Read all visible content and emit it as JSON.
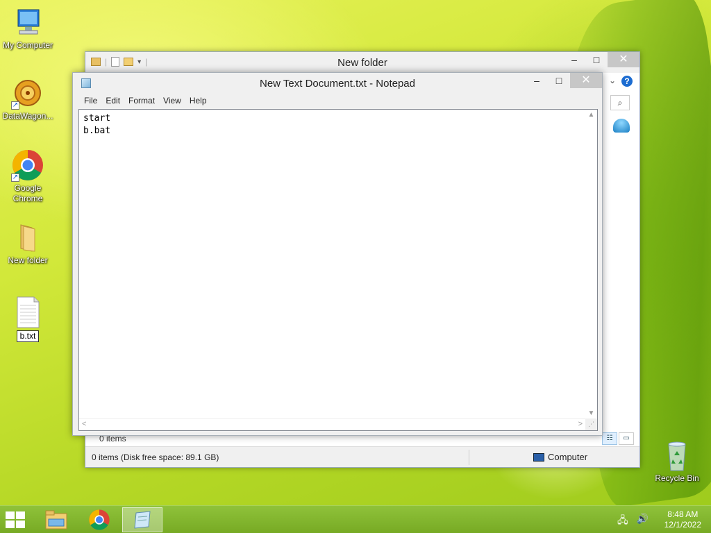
{
  "desktop": {
    "icons": [
      {
        "label": "My Computer",
        "icon": "my-computer-icon"
      },
      {
        "label": "DataWagon...",
        "icon": "datawagon-icon"
      },
      {
        "label": "Google Chrome",
        "icon": "chrome-icon"
      },
      {
        "label": "New folder",
        "icon": "folder-icon"
      },
      {
        "label": "b.txt",
        "icon": "text-file-icon"
      },
      {
        "label": "Recycle Bin",
        "icon": "recycle-bin-icon"
      }
    ]
  },
  "explorer": {
    "title": "New folder",
    "items_count": "0 items",
    "status_left": "0 items (Disk free space: 89.1 GB)",
    "status_right": "Computer",
    "help": "?"
  },
  "notepad": {
    "title": "New Text Document.txt - Notepad",
    "menu": [
      "File",
      "Edit",
      "Format",
      "View",
      "Help"
    ],
    "content": "start\nb.bat"
  },
  "window_buttons": {
    "minimize": "–",
    "maximize": "□",
    "close": "✕"
  },
  "taskbar": {
    "items": [
      "file-explorer-icon",
      "chrome-icon",
      "notepad-icon"
    ],
    "active": "notepad-icon",
    "time": "8:48 AM",
    "date": "12/1/2022"
  },
  "colors": {
    "accent": "#1c6cd1",
    "taskbar": "#8fc23a",
    "close_button": "#c7c7c7"
  }
}
